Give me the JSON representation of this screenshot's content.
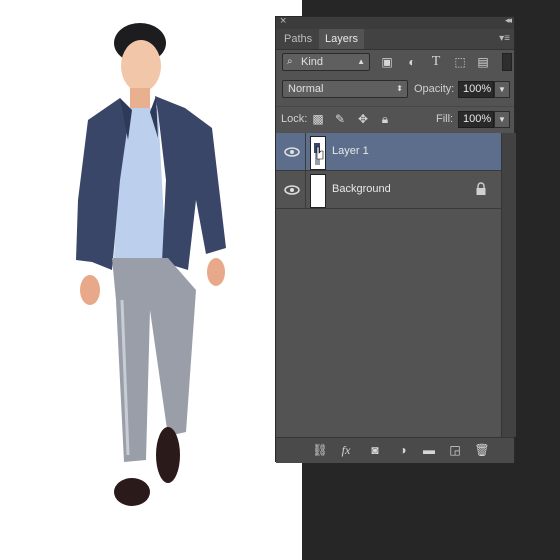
{
  "panel": {
    "close_icon": "close-icon",
    "collapse_icon": "collapse-icon",
    "tabs": [
      {
        "label": "Paths"
      },
      {
        "label": "Layers"
      }
    ],
    "menu_icon": "panel-menu-icon"
  },
  "filter": {
    "kind_label": "Kind",
    "icons": [
      "image-filter-icon",
      "adjustment-filter-icon",
      "type-filter-icon",
      "shape-filter-icon",
      "smart-object-filter-icon"
    ]
  },
  "blend": {
    "mode": "Normal",
    "opacity_label": "Opacity:",
    "opacity_value": "100%"
  },
  "lock": {
    "label": "Lock:",
    "fill_label": "Fill:",
    "fill_value": "100%"
  },
  "layers": [
    {
      "name": "Layer 1",
      "selected": true
    },
    {
      "name": "Background",
      "selected": false,
      "locked": true
    }
  ],
  "footer_icons": [
    "link-icon",
    "fx-icon",
    "mask-icon",
    "adjustment-icon",
    "folder-icon",
    "new-layer-icon",
    "trash-icon"
  ],
  "footer": {
    "fx_label": "fx"
  },
  "colors": {
    "panel_bg": "#535353",
    "selected_layer": "#5c6e8c",
    "canvas": "#ffffff",
    "jacket": "#3a4668",
    "shirt": "#bcd0ee",
    "pants": "#9a9ea8"
  }
}
